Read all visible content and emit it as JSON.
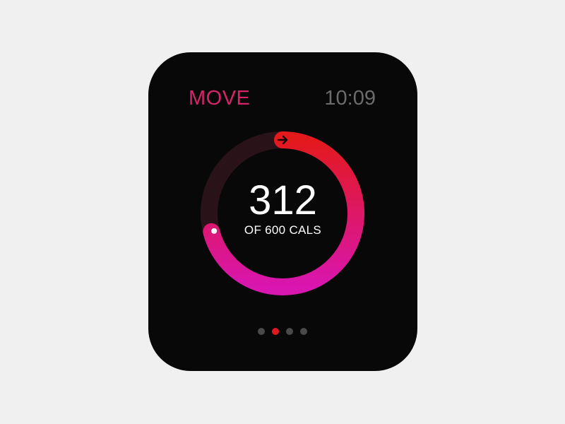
{
  "app": {
    "title": "MOVE",
    "title_color": "#d6236a"
  },
  "clock": {
    "time": "10:09"
  },
  "activity": {
    "current": "312",
    "caption": "OF 600 CALS",
    "progress_fraction": 0.71,
    "ring_colors": {
      "start": "#e3191c",
      "end": "#d816b0",
      "track": "#2a1219"
    },
    "start_icon": "arrow-right-icon"
  },
  "pagination": {
    "pages": 4,
    "active_index": 1,
    "active_color": "#e0191f"
  }
}
